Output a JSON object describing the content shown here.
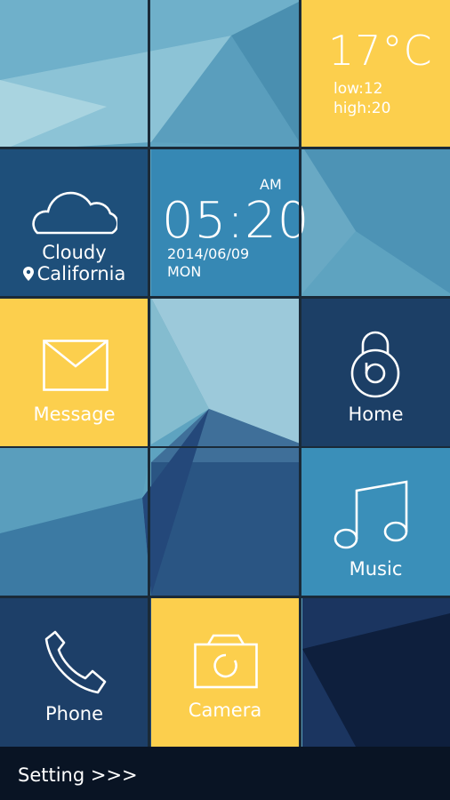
{
  "weather": {
    "temperature": "17°C",
    "low": "low:12",
    "high": "high:20",
    "condition": "Cloudy",
    "location": "California"
  },
  "clock": {
    "time": "05:20",
    "ampm": "AM",
    "date": "2014/06/09",
    "day": "MON"
  },
  "tiles": {
    "message": "Message",
    "home": "Home",
    "music": "Music",
    "phone": "Phone",
    "camera": "Camera"
  },
  "footer": {
    "setting_label": "Setting >>>"
  },
  "colors": {
    "yellow": "#fccf4d",
    "navy": "#1c3f66",
    "teal": "#2f87b3",
    "bar": "#091424"
  }
}
